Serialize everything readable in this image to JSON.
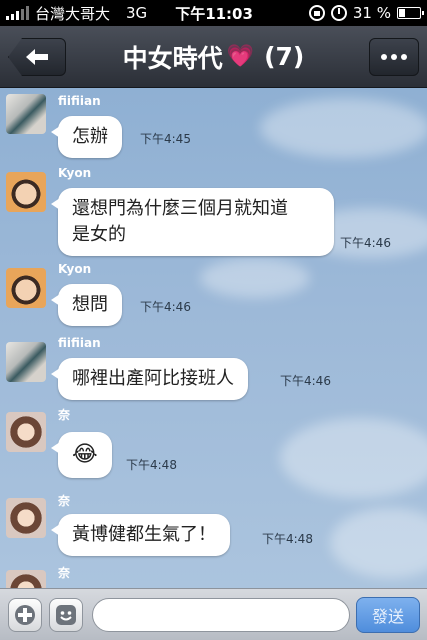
{
  "status_bar": {
    "carrier": "台灣大哥大",
    "network": "3G",
    "time": "下午11:03",
    "battery": "31 %",
    "battery_level": 0.31
  },
  "header": {
    "title": "中女時代",
    "heart": "💗",
    "member_count": "(7)",
    "back_icon": "arrow-left-icon",
    "more_icon": "ellipsis-icon"
  },
  "messages": [
    {
      "sender": "fiifiian",
      "text": "怎辦",
      "time": "下午4:45"
    },
    {
      "sender": "Kyon",
      "text_line1": "還想門為什麼三個月就知道",
      "text_line2": "是女的",
      "time": "下午4:46"
    },
    {
      "sender": "Kyon",
      "text": "想問",
      "time": "下午4:46"
    },
    {
      "sender": "fiifiian",
      "text": "哪裡出產阿比接班人",
      "time": "下午4:46"
    },
    {
      "sender": "奈",
      "text": "😂",
      "time": "下午4:48"
    },
    {
      "sender": "奈",
      "text": "黃博健都生氣了！",
      "time": "下午4:48"
    },
    {
      "sender": "奈"
    }
  ],
  "input_bar": {
    "placeholder": "",
    "send_label": "發送"
  }
}
